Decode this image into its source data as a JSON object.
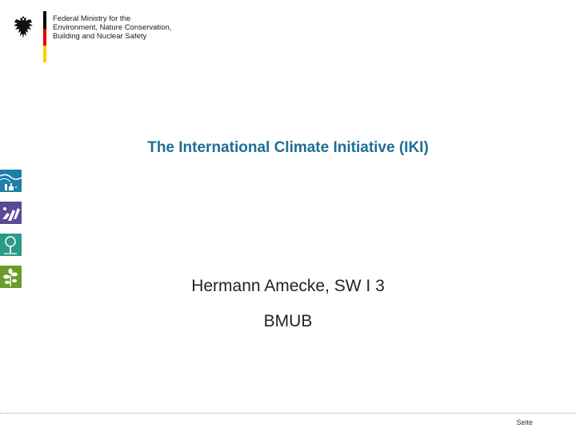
{
  "header": {
    "ministry_lines": [
      "Federal Ministry for the",
      "Environment, Nature Conservation,",
      "Building and Nuclear Safety"
    ],
    "emblem": "federal-eagle-icon",
    "flag_colors": [
      "#000000",
      "#dd0000",
      "#ffcc00"
    ]
  },
  "slide": {
    "title": "The International Climate Initiative (IKI)",
    "speaker": "Hermann Amecke, SW I 3",
    "organization": "BMUB"
  },
  "side_icons": [
    {
      "name": "industry-climate-icon",
      "color": "#1f7fa6"
    },
    {
      "name": "adaptation-hands-icon",
      "color": "#5a4a94"
    },
    {
      "name": "forest-tree-icon",
      "color": "#2a9a8a"
    },
    {
      "name": "biodiversity-plant-icon",
      "color": "#6b9a2a"
    }
  ],
  "footer": {
    "page_label": "Seite"
  },
  "colors": {
    "title": "#1f6e96",
    "body_text": "#222222",
    "footer_line": "#9aaec4"
  }
}
